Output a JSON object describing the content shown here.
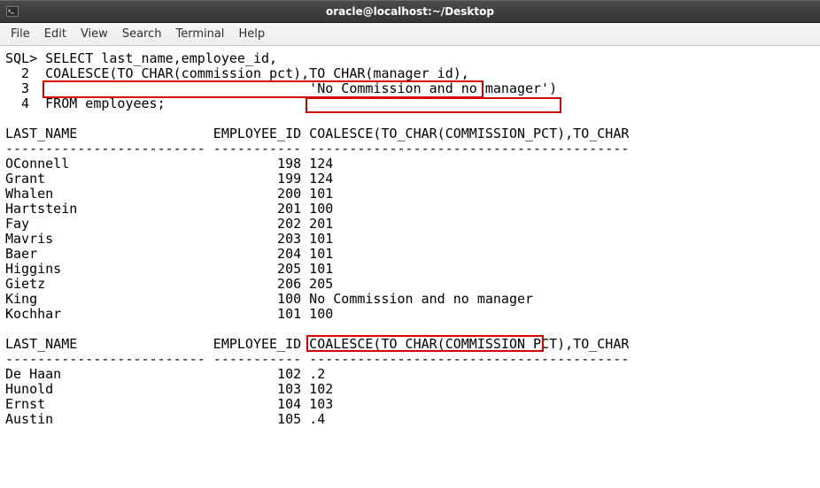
{
  "window": {
    "title": "oracle@localhost:~/Desktop"
  },
  "menu": {
    "items": [
      "File",
      "Edit",
      "View",
      "Search",
      "Terminal",
      "Help"
    ]
  },
  "terminal": {
    "prompt": "SQL>",
    "query_lines": [
      "SQL> SELECT last_name,employee_id,",
      "  2  COALESCE(TO_CHAR(commission_pct),TO_CHAR(manager_id),",
      "  3                                   'No Commission and no manager')",
      "  4  FROM employees;"
    ],
    "header_cols": "LAST_NAME                 EMPLOYEE_ID COALESCE(TO_CHAR(COMMISSION_PCT),TO_CHAR",
    "header_sep": "------------------------- ----------- ----------------------------------------",
    "rows1": [
      "OConnell                          198 124",
      "Grant                             199 124",
      "Whalen                            200 101",
      "Hartstein                         201 100",
      "Fay                               202 201",
      "Mavris                            203 101",
      "Baer                              204 101",
      "Higgins                           205 101",
      "Gietz                             206 205",
      "King                              100 No Commission and no manager",
      "Kochhar                           101 100"
    ],
    "rows2": [
      "De Haan                           102 .2",
      "Hunold                            103 102",
      "Ernst                             104 103",
      "Austin                            105 .4"
    ]
  },
  "chart_data": {
    "type": "table",
    "columns": [
      "LAST_NAME",
      "EMPLOYEE_ID",
      "COALESCE(TO_CHAR(COMMISSION_PCT),TO_CHAR(MANAGER_ID),'No Commission and no manager')"
    ],
    "rows": [
      {
        "LAST_NAME": "OConnell",
        "EMPLOYEE_ID": 198,
        "COALESCE": "124"
      },
      {
        "LAST_NAME": "Grant",
        "EMPLOYEE_ID": 199,
        "COALESCE": "124"
      },
      {
        "LAST_NAME": "Whalen",
        "EMPLOYEE_ID": 200,
        "COALESCE": "101"
      },
      {
        "LAST_NAME": "Hartstein",
        "EMPLOYEE_ID": 201,
        "COALESCE": "100"
      },
      {
        "LAST_NAME": "Fay",
        "EMPLOYEE_ID": 202,
        "COALESCE": "201"
      },
      {
        "LAST_NAME": "Mavris",
        "EMPLOYEE_ID": 203,
        "COALESCE": "101"
      },
      {
        "LAST_NAME": "Baer",
        "EMPLOYEE_ID": 204,
        "COALESCE": "101"
      },
      {
        "LAST_NAME": "Higgins",
        "EMPLOYEE_ID": 205,
        "COALESCE": "101"
      },
      {
        "LAST_NAME": "Gietz",
        "EMPLOYEE_ID": 206,
        "COALESCE": "205"
      },
      {
        "LAST_NAME": "King",
        "EMPLOYEE_ID": 100,
        "COALESCE": "No Commission and no manager"
      },
      {
        "LAST_NAME": "Kochhar",
        "EMPLOYEE_ID": 101,
        "COALESCE": "100"
      },
      {
        "LAST_NAME": "De Haan",
        "EMPLOYEE_ID": 102,
        "COALESCE": ".2"
      },
      {
        "LAST_NAME": "Hunold",
        "EMPLOYEE_ID": 103,
        "COALESCE": "102"
      },
      {
        "LAST_NAME": "Ernst",
        "EMPLOYEE_ID": 104,
        "COALESCE": "103"
      },
      {
        "LAST_NAME": "Austin",
        "EMPLOYEE_ID": 105,
        "COALESCE": ".4"
      }
    ]
  }
}
